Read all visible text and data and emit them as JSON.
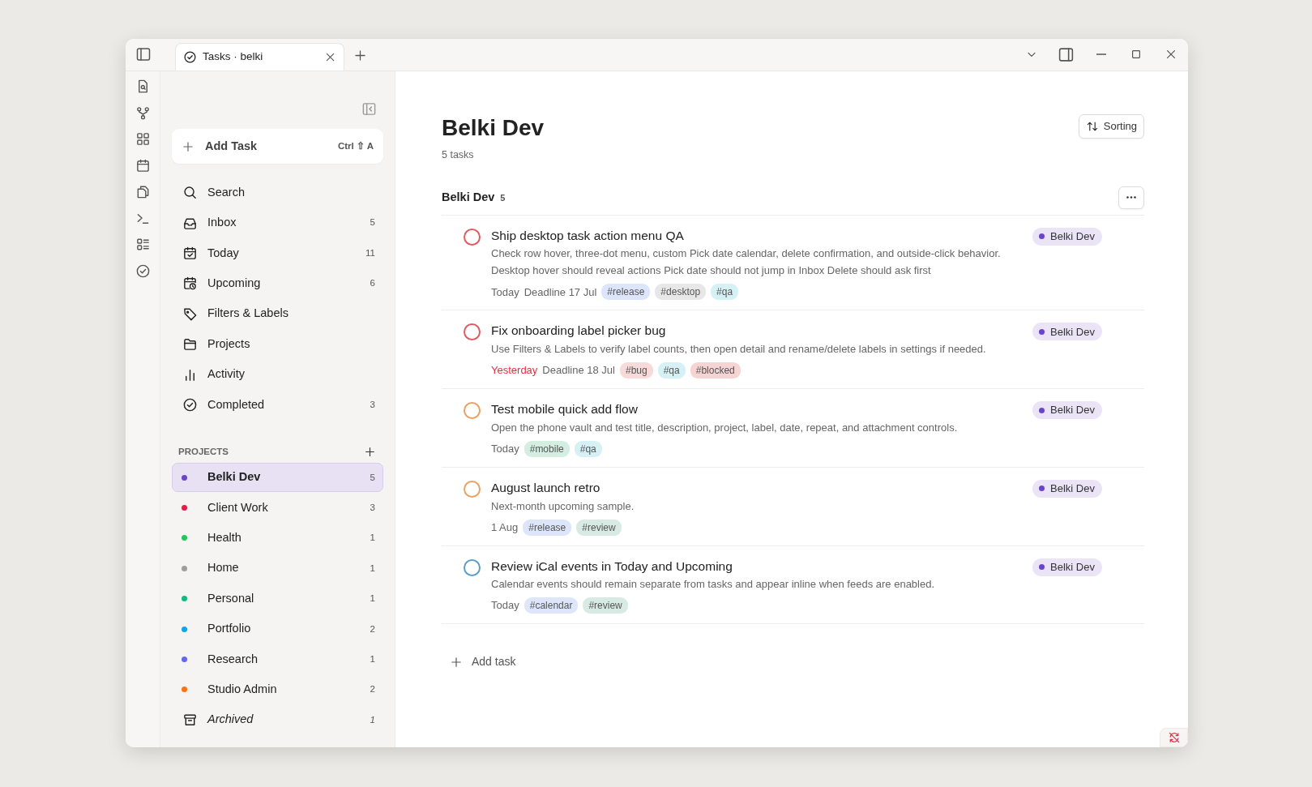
{
  "window": {
    "tab": {
      "title": "Tasks · belki"
    }
  },
  "sidebar": {
    "add_task": {
      "label": "Add Task",
      "shortcut": [
        "Ctrl",
        "⇧",
        "A"
      ]
    },
    "nav": [
      {
        "label": "Search"
      },
      {
        "label": "Inbox",
        "count": "5"
      },
      {
        "label": "Today",
        "count": "11"
      },
      {
        "label": "Upcoming",
        "count": "6"
      },
      {
        "label": "Filters & Labels"
      },
      {
        "label": "Projects"
      },
      {
        "label": "Activity"
      },
      {
        "label": "Completed",
        "count": "3"
      }
    ],
    "projects_header": "PROJECTS",
    "projects": [
      {
        "kind": "project",
        "name": "Belki Dev",
        "count": "5",
        "color": "#6a45c8",
        "selected": true
      },
      {
        "kind": "project",
        "name": "Client Work",
        "count": "3",
        "color": "#e11d48",
        "selected": false
      },
      {
        "kind": "project",
        "name": "Health",
        "count": "1",
        "color": "#22c55e",
        "selected": false
      },
      {
        "kind": "project",
        "name": "Home",
        "count": "1",
        "color": "#9e9e9e",
        "selected": false
      },
      {
        "kind": "project",
        "name": "Personal",
        "count": "1",
        "color": "#10b981",
        "selected": false
      },
      {
        "kind": "project",
        "name": "Portfolio",
        "count": "2",
        "color": "#0ea5e9",
        "selected": false
      },
      {
        "kind": "project",
        "name": "Research",
        "count": "1",
        "color": "#6366f1",
        "selected": false
      },
      {
        "kind": "project",
        "name": "Studio Admin",
        "count": "2",
        "color": "#f97316",
        "selected": false
      },
      {
        "kind": "archive",
        "name": "Archived",
        "count": "1",
        "selected": false
      }
    ]
  },
  "main": {
    "title": "Belki Dev",
    "subtitle": "5 tasks",
    "sort_button": "Sorting",
    "section": {
      "name": "Belki Dev",
      "count": "5"
    },
    "tasks": [
      {
        "title": "Ship desktop task action menu QA",
        "color": "#e05a5f",
        "description": [
          "Check row hover, three-dot menu, custom Pick date calendar, delete confirmation, and outside-click behavior.",
          "Desktop hover should reveal actions Pick date should not jump in Inbox Delete should ask first"
        ],
        "date": "Today",
        "overdue": false,
        "deadline": "Deadline 17 Jul",
        "labels": [
          {
            "text": "#release",
            "color": "#dde5fb"
          },
          {
            "text": "#desktop",
            "color": "#e7e7e7"
          },
          {
            "text": "#qa",
            "color": "#d6f1f5"
          }
        ],
        "project": {
          "name": "Belki Dev",
          "color": "#6a45c8"
        }
      },
      {
        "title": "Fix onboarding label picker bug",
        "color": "#e05a5f",
        "description": [
          "Use Filters & Labels to verify label counts, then open detail and rename/delete labels in settings if needed."
        ],
        "date": "Yesterday",
        "overdue": true,
        "deadline": "Deadline 18 Jul",
        "labels": [
          {
            "text": "#bug",
            "color": "#f8dada"
          },
          {
            "text": "#qa",
            "color": "#d6f1f5"
          },
          {
            "text": "#blocked",
            "color": "#f6d4d4"
          }
        ],
        "project": {
          "name": "Belki Dev",
          "color": "#6a45c8"
        }
      },
      {
        "title": "Test mobile quick add flow",
        "color": "#e9a262",
        "description": [
          "Open the phone vault and test title, description, project, label, date, repeat, and attachment controls."
        ],
        "date": "Today",
        "overdue": false,
        "labels": [
          {
            "text": "#mobile",
            "color": "#d4eee2"
          },
          {
            "text": "#qa",
            "color": "#d6f1f5"
          }
        ],
        "project": {
          "name": "Belki Dev",
          "color": "#6a45c8"
        }
      },
      {
        "title": "August launch retro",
        "color": "#e9a262",
        "description": [
          "Next-month upcoming sample."
        ],
        "date": "1 Aug",
        "overdue": false,
        "labels": [
          {
            "text": "#release",
            "color": "#dde5fb"
          },
          {
            "text": "#review",
            "color": "#d7ebe4"
          }
        ],
        "project": {
          "name": "Belki Dev",
          "color": "#6a45c8"
        }
      },
      {
        "title": "Review iCal events in Today and Upcoming",
        "color": "#5a9ec8",
        "description": [
          "Calendar events should remain separate from tasks and appear inline when feeds are enabled."
        ],
        "date": "Today",
        "overdue": false,
        "labels": [
          {
            "text": "#calendar",
            "color": "#dde6fb"
          },
          {
            "text": "#review",
            "color": "#d7ebe4"
          }
        ],
        "project": {
          "name": "Belki Dev",
          "color": "#6a45c8"
        }
      }
    ],
    "add_task": "Add task"
  }
}
